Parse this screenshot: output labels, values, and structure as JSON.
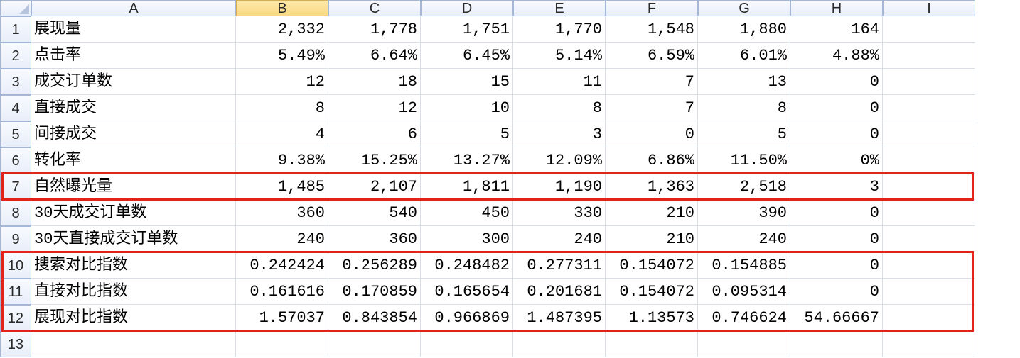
{
  "columns": [
    "A",
    "B",
    "C",
    "D",
    "E",
    "F",
    "G",
    "H",
    "I"
  ],
  "rowCount": 13,
  "activeCol": "B",
  "rows": [
    {
      "label": "展现量",
      "vals": [
        "2,332",
        "1,778",
        "1,751",
        "1,770",
        "1,548",
        "1,880",
        "164",
        ""
      ]
    },
    {
      "label": "点击率",
      "vals": [
        "5.49%",
        "6.64%",
        "6.45%",
        "5.14%",
        "6.59%",
        "6.01%",
        "4.88%",
        ""
      ]
    },
    {
      "label": "成交订单数",
      "vals": [
        "12",
        "18",
        "15",
        "11",
        "7",
        "13",
        "0",
        ""
      ]
    },
    {
      "label": "直接成交",
      "vals": [
        "8",
        "12",
        "10",
        "8",
        "7",
        "8",
        "0",
        ""
      ]
    },
    {
      "label": "间接成交",
      "vals": [
        "4",
        "6",
        "5",
        "3",
        "0",
        "5",
        "0",
        ""
      ]
    },
    {
      "label": "转化率",
      "vals": [
        "9.38%",
        "15.25%",
        "13.27%",
        "12.09%",
        "6.86%",
        "11.50%",
        "0%",
        ""
      ]
    },
    {
      "label": "自然曝光量",
      "vals": [
        "1,485",
        "2,107",
        "1,811",
        "1,190",
        "1,363",
        "2,518",
        "3",
        ""
      ]
    },
    {
      "label": "30天成交订单数",
      "vals": [
        "360",
        "540",
        "450",
        "330",
        "210",
        "390",
        "0",
        ""
      ]
    },
    {
      "label": "30天直接成交订单数",
      "vals": [
        "240",
        "360",
        "300",
        "240",
        "210",
        "240",
        "0",
        ""
      ]
    },
    {
      "label": "搜索对比指数",
      "vals": [
        "0.242424",
        "0.256289",
        "0.248482",
        "0.277311",
        "0.154072",
        "0.154885",
        "0",
        ""
      ]
    },
    {
      "label": "直接对比指数",
      "vals": [
        "0.161616",
        "0.170859",
        "0.165654",
        "0.201681",
        "0.154072",
        "0.095314",
        "0",
        ""
      ]
    },
    {
      "label": "展现对比指数",
      "vals": [
        "1.57037",
        "0.843854",
        "0.966869",
        "1.487395",
        "1.13573",
        "0.746624",
        "54.66667",
        ""
      ]
    },
    {
      "label": "",
      "vals": [
        "",
        "",
        "",
        "",
        "",
        "",
        "",
        ""
      ]
    }
  ],
  "highlights": {
    "row7": true,
    "rows10_12": true
  }
}
